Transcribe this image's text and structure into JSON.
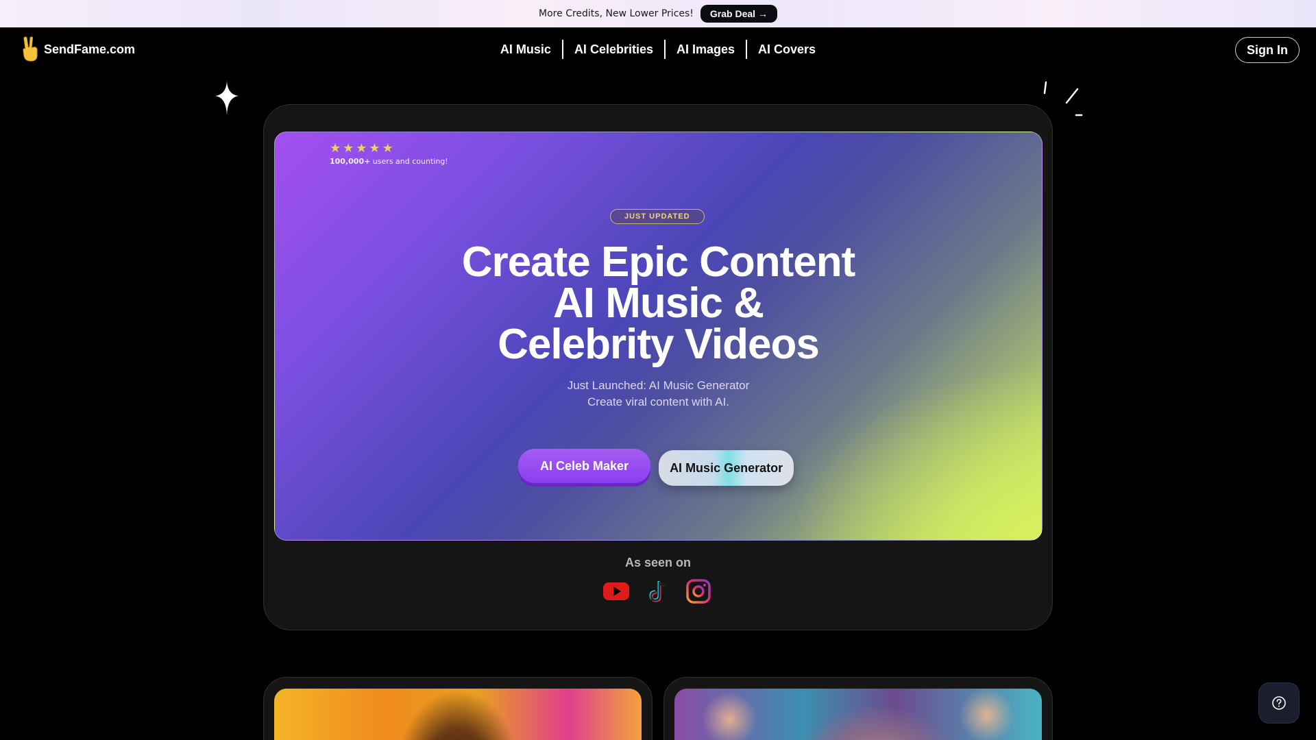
{
  "banner": {
    "text": "More Credits, New Lower Prices!",
    "button_label": "Grab Deal →"
  },
  "nav": {
    "brand": "SendFame.com",
    "links": [
      "AI Music",
      "AI Celebrities",
      "AI Images",
      "AI Covers"
    ],
    "signin_label": "Sign In"
  },
  "hero": {
    "rating": {
      "star_count": 5,
      "count": "100,000+",
      "suffix": "users and counting!"
    },
    "badge": "JUST UPDATED",
    "headline": [
      "Create Epic Content",
      "AI Music &",
      "Celebrity Videos"
    ],
    "subtitle": [
      "Just Launched: AI Music Generator",
      "Create viral content with AI."
    ],
    "primary_cta": "AI Celeb Maker",
    "secondary_cta": "AI Music Generator",
    "seen_on_title": "As seen on",
    "seen_on_icons": [
      "youtube-icon",
      "tiktok-icon",
      "instagram-icon"
    ]
  },
  "colors": {
    "accent_purple": "#8a3ff0",
    "accent_lime": "#d6ee62",
    "background": "#000000"
  },
  "icons": {
    "logo": "peace-hand-icon",
    "help": "question-circle-icon"
  }
}
